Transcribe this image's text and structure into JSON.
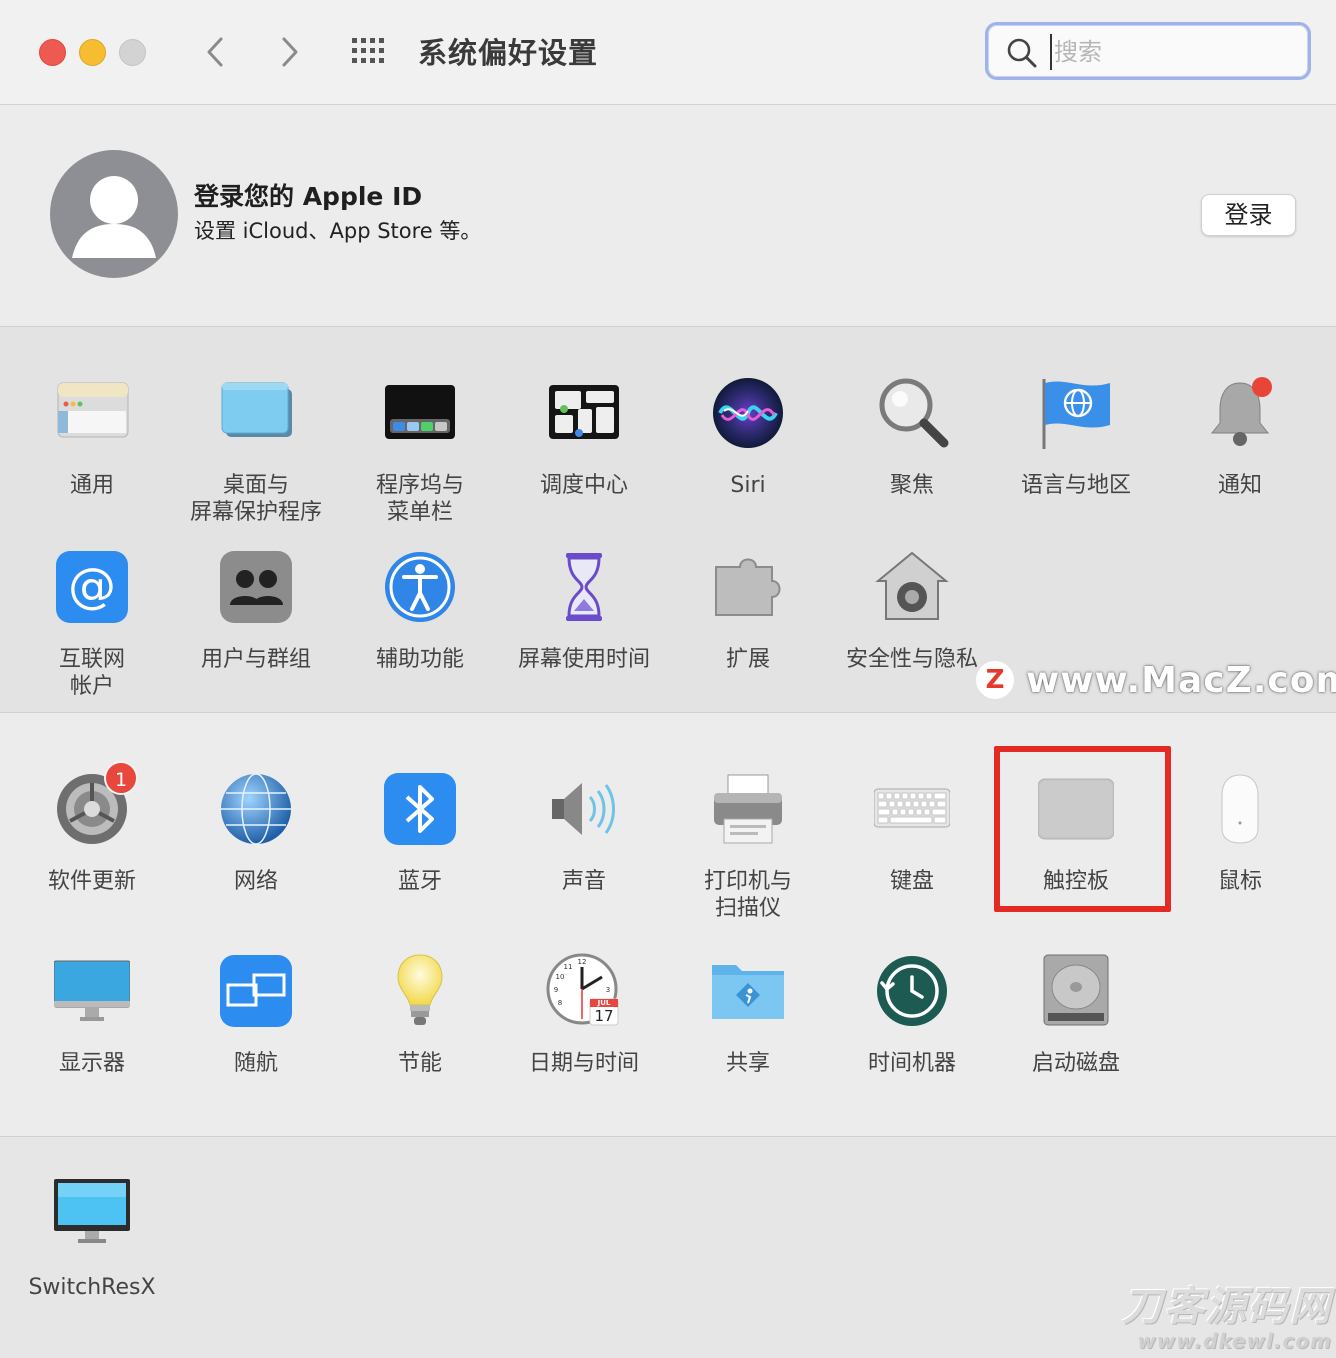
{
  "window": {
    "title": "系统偏好设置"
  },
  "search": {
    "placeholder": "搜索"
  },
  "account": {
    "title": "登录您的 Apple ID",
    "subtitle": "设置 iCloud、App Store 等。",
    "login_label": "登录"
  },
  "section1": [
    {
      "label": "通用",
      "icon": "general-icon"
    },
    {
      "label": "桌面与\n屏幕保护程序",
      "icon": "desktop-icon"
    },
    {
      "label": "程序坞与\n菜单栏",
      "icon": "dock-icon"
    },
    {
      "label": "调度中心",
      "icon": "mission-control-icon"
    },
    {
      "label": "Siri",
      "icon": "siri-icon"
    },
    {
      "label": "聚焦",
      "icon": "spotlight-icon"
    },
    {
      "label": "语言与地区",
      "icon": "language-region-icon"
    },
    {
      "label": "通知",
      "icon": "notifications-icon"
    },
    {
      "label": "互联网\n帐户",
      "icon": "internet-accounts-icon"
    },
    {
      "label": "用户与群组",
      "icon": "users-groups-icon"
    },
    {
      "label": "辅助功能",
      "icon": "accessibility-icon"
    },
    {
      "label": "屏幕使用时间",
      "icon": "screen-time-icon"
    },
    {
      "label": "扩展",
      "icon": "extensions-icon"
    },
    {
      "label": "安全性与隐私",
      "icon": "security-icon"
    }
  ],
  "section2": [
    {
      "label": "软件更新",
      "icon": "software-update-icon",
      "badge": "1"
    },
    {
      "label": "网络",
      "icon": "network-icon"
    },
    {
      "label": "蓝牙",
      "icon": "bluetooth-icon"
    },
    {
      "label": "声音",
      "icon": "sound-icon"
    },
    {
      "label": "打印机与\n扫描仪",
      "icon": "printer-icon"
    },
    {
      "label": "键盘",
      "icon": "keyboard-icon"
    },
    {
      "label": "触控板",
      "icon": "trackpad-icon"
    },
    {
      "label": "鼠标",
      "icon": "mouse-icon"
    },
    {
      "label": "显示器",
      "icon": "displays-icon"
    },
    {
      "label": "随航",
      "icon": "sidecar-icon"
    },
    {
      "label": "节能",
      "icon": "energy-saver-icon"
    },
    {
      "label": "日期与时间",
      "icon": "date-time-icon"
    },
    {
      "label": "共享",
      "icon": "sharing-icon"
    },
    {
      "label": "时间机器",
      "icon": "time-machine-icon"
    },
    {
      "label": "启动磁盘",
      "icon": "startup-disk-icon"
    }
  ],
  "section3": [
    {
      "label": "SwitchResX",
      "icon": "switchresx-icon"
    }
  ],
  "clock": {
    "month": "JUL",
    "day": "17"
  },
  "watermarks": {
    "macz_logo": "Z",
    "macz": "www.MacZ.com",
    "dkewl_title": "刀客源码网",
    "dkewl_url": "www.dkewl.com"
  },
  "colors": {
    "highlight": "#e42a25",
    "badge": "#e9473c",
    "search_focus": "#9fb3ea"
  }
}
